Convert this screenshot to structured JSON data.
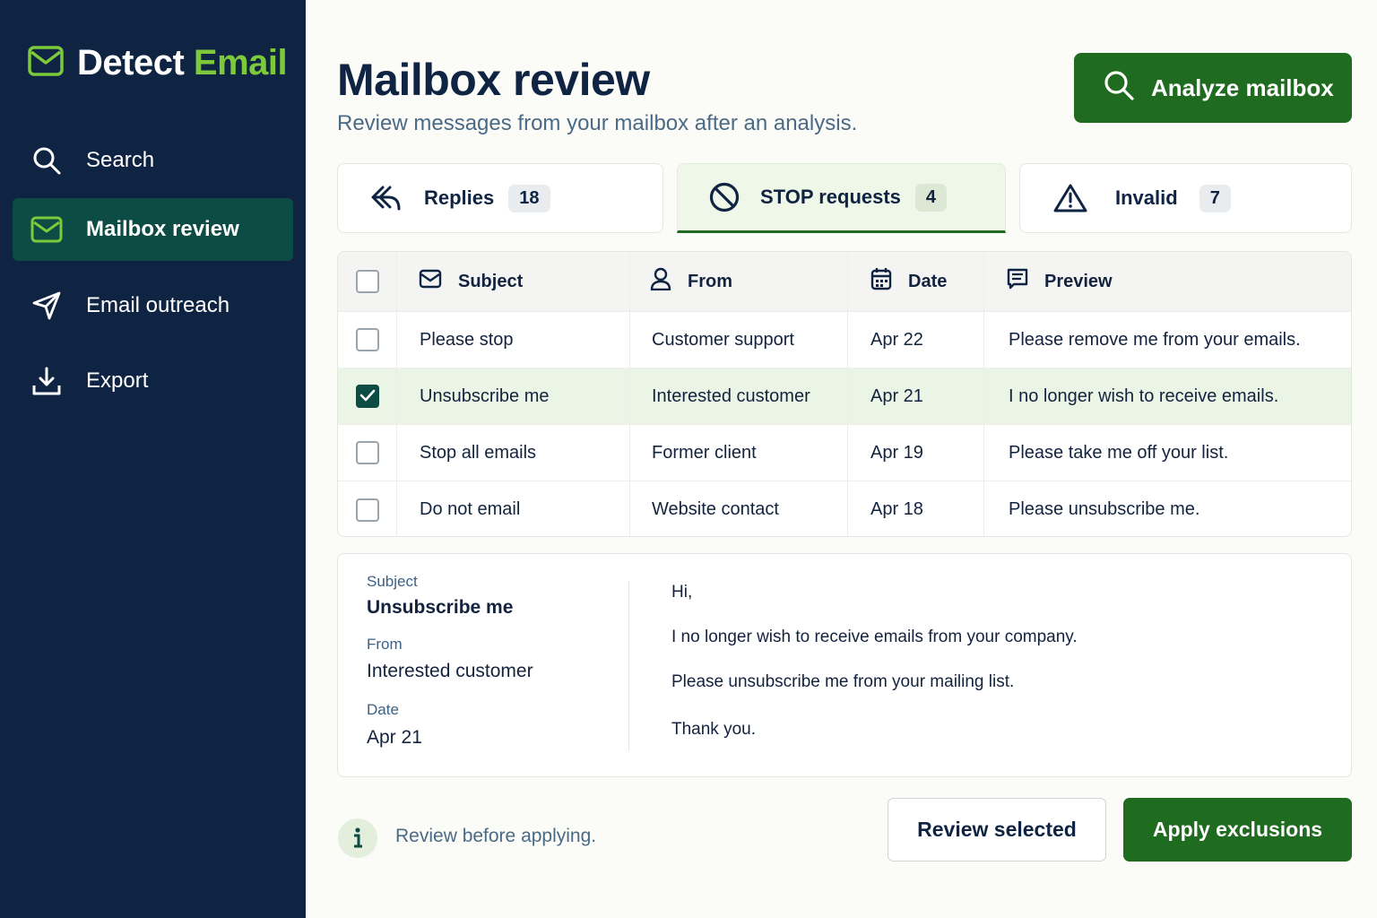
{
  "brand": {
    "name_part1": "Detect",
    "name_part2": "Email",
    "icon": "mail-icon",
    "accent_color": "#7cc93b"
  },
  "sidebar": {
    "items": [
      {
        "label": "Search",
        "icon": "search-icon",
        "active": false
      },
      {
        "label": "Mailbox review",
        "icon": "mail-icon",
        "active": true
      },
      {
        "label": "Email outreach",
        "icon": "send-icon",
        "active": false
      },
      {
        "label": "Export",
        "icon": "download-icon",
        "active": false
      }
    ]
  },
  "header": {
    "title": "Mailbox review",
    "subtitle": "Review messages from your mailbox after an analysis.",
    "analyze_label": "Analyze mailbox",
    "analyze_icon": "search-icon"
  },
  "tabs": [
    {
      "label": "Replies",
      "count": "18",
      "icon": "reply-icon",
      "active": false
    },
    {
      "label": "STOP requests",
      "count": "4",
      "icon": "block-icon",
      "active": true
    },
    {
      "label": "Invalid",
      "count": "7",
      "icon": "warning-icon",
      "active": false
    }
  ],
  "table": {
    "columns": [
      {
        "label": "Subject",
        "icon": "mail-icon"
      },
      {
        "label": "From",
        "icon": "user-icon"
      },
      {
        "label": "Date",
        "icon": "calendar-icon"
      },
      {
        "label": "Preview",
        "icon": "message-icon"
      }
    ],
    "rows": [
      {
        "subject": "Please stop",
        "from": "Customer support",
        "date": "Apr 22",
        "preview": "Please remove me from your emails.",
        "checked": false
      },
      {
        "subject": "Unsubscribe me",
        "from": "Interested customer",
        "date": "Apr 21",
        "preview": "I no longer wish to receive emails.",
        "checked": true
      },
      {
        "subject": "Stop all emails",
        "from": "Former client",
        "date": "Apr 19",
        "preview": "Please take me off your list.",
        "checked": false
      },
      {
        "subject": "Do not email",
        "from": "Website contact",
        "date": "Apr 18",
        "preview": "Please unsubscribe me.",
        "checked": false
      }
    ]
  },
  "detail": {
    "subject_label": "Subject",
    "subject": "Unsubscribe me",
    "from_label": "From",
    "from": "Interested customer",
    "date_label": "Date",
    "date": "Apr 21",
    "body": [
      "Hi,",
      "I no longer wish to receive emails from your company.",
      "Please unsubscribe me from your mailing list.",
      "Thank you."
    ]
  },
  "footer": {
    "info_text": "Review before applying.",
    "info_icon": "info-icon",
    "review_label": "Review selected",
    "apply_label": "Apply exclusions"
  },
  "colors": {
    "sidebar": "#0f2342",
    "active_nav": "#0d4c45",
    "primary_button": "#1f6b1f",
    "selected_row": "#eaf5e5"
  }
}
